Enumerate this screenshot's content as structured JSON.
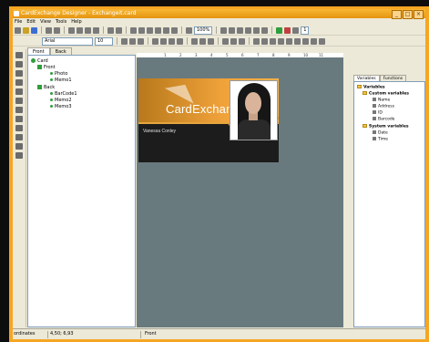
{
  "window": {
    "title": "CardExchange Designer - Exchangeit.card",
    "controls": [
      "_",
      "□",
      "×"
    ]
  },
  "menu": [
    "File",
    "Edit",
    "View",
    "Tools",
    "Help"
  ],
  "toolbar": {
    "zoom": "100%",
    "page_select": "1",
    "font_name": "Arial",
    "font_size": "10"
  },
  "left_tabs": [
    "Front",
    "Back"
  ],
  "tree": {
    "root": "Card",
    "front": {
      "label": "Front",
      "children": [
        "Photo",
        "Memo1"
      ]
    },
    "back": {
      "label": "Back",
      "children": [
        "BarCode1",
        "Memo2",
        "Memo3"
      ]
    }
  },
  "ruler": {
    "marks": [
      "1",
      "2",
      "3",
      "4",
      "5",
      "6",
      "7",
      "8",
      "9",
      "10",
      "11"
    ]
  },
  "card": {
    "brand": "CardExchange",
    "holder_name": "Vanessa Conley"
  },
  "right_tabs": [
    "Variables",
    "Functions"
  ],
  "variables": {
    "root": "Variables",
    "custom": {
      "label": "Custom variables",
      "items": [
        "Name",
        "Address",
        "ID",
        "Barcode"
      ]
    },
    "system": {
      "label": "System variables",
      "items": [
        "Date",
        "Time"
      ]
    }
  },
  "status": {
    "coords_label": "ordinates",
    "coords_value": "4,50; 6,93",
    "side": "Front"
  },
  "colors": {
    "accent": "#f5a623",
    "canvas": "#697a7f"
  }
}
